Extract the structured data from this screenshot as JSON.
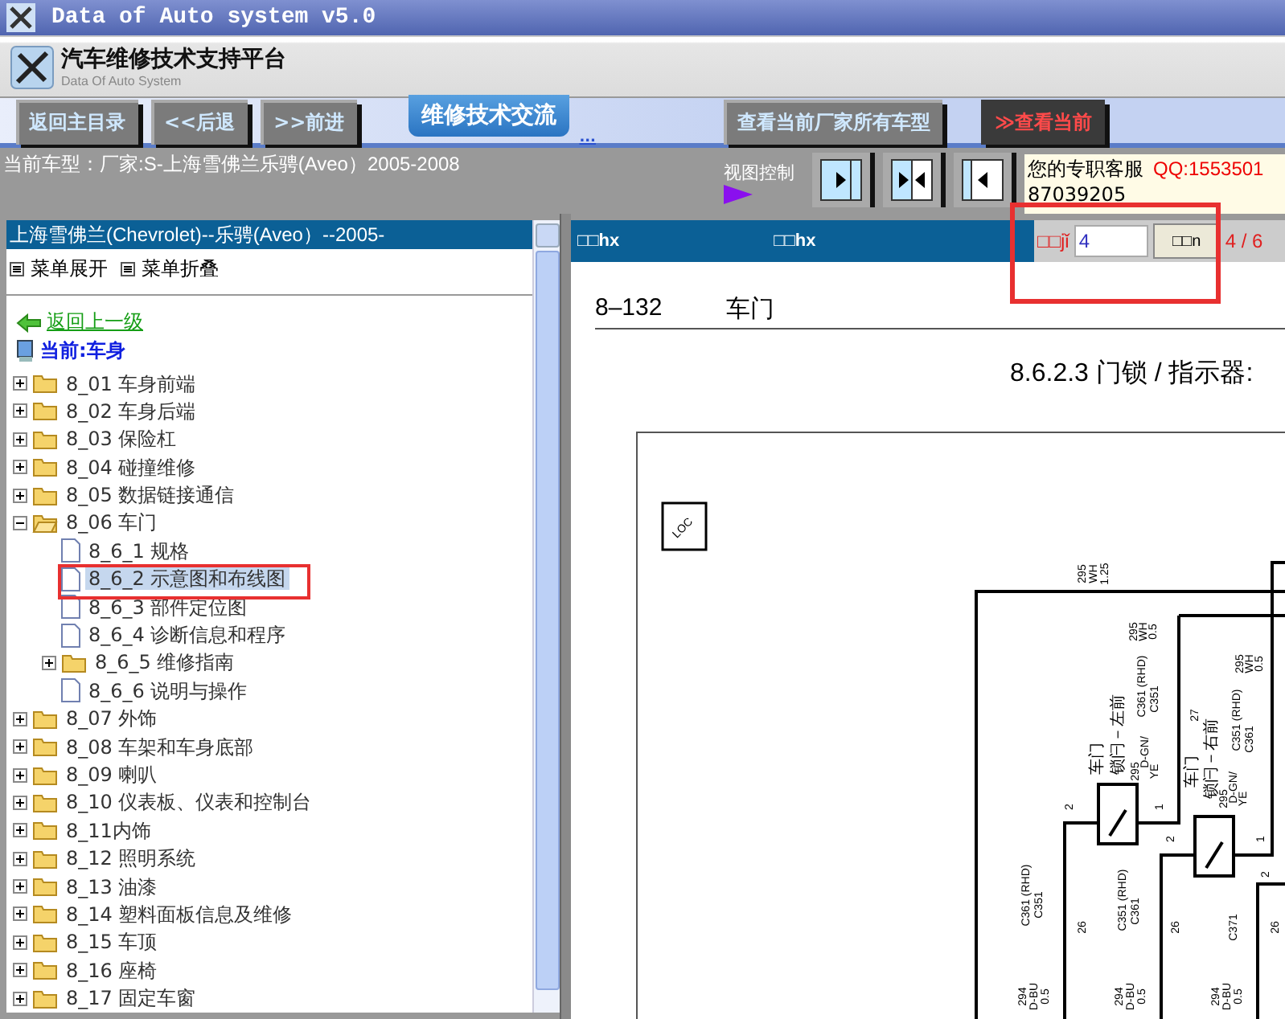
{
  "window": {
    "title": "Data of Auto system v5.0"
  },
  "header": {
    "title": "汽车维修技术支持平台",
    "subtitle": "Data Of Auto System"
  },
  "nav": {
    "buttons": [
      {
        "label": "返回主目录",
        "kind": "grey"
      },
      {
        "label": "<<后退",
        "kind": "grey"
      },
      {
        "label": ">>前进",
        "kind": "grey"
      },
      {
        "label": "维修技术交流",
        "kind": "tab"
      },
      {
        "label": "...",
        "kind": "link"
      },
      {
        "label": "查看当前厂家所有车型",
        "kind": "grey"
      },
      {
        "label": "≫查看当前",
        "kind": "red"
      }
    ]
  },
  "info_bar": {
    "current_model": "当前车型：厂家:S-上海雪佛兰乐骋(Aveo）2005-2008",
    "view_control": "视图控制",
    "service_label": "您的专职客服",
    "service_qq": "QQ:1553501",
    "service_phone": "87039205"
  },
  "sidebar": {
    "title": "上海雪佛兰(Chevrolet)--乐骋(Aveo）--2005-",
    "expand_all": "菜单展开",
    "collapse_all": "菜单折叠",
    "back_link": "返回上一级",
    "current": "当前:车身",
    "tree": [
      {
        "label": "8_01 车身前端",
        "kind": "folder",
        "expanded": false,
        "selected": false
      },
      {
        "label": "8_02 车身后端",
        "kind": "folder",
        "expanded": false,
        "selected": false
      },
      {
        "label": "8_03 保险杠",
        "kind": "folder",
        "expanded": false,
        "selected": false
      },
      {
        "label": "8_04 碰撞维修",
        "kind": "folder",
        "expanded": false,
        "selected": false
      },
      {
        "label": "8_05 数据链接通信",
        "kind": "folder",
        "expanded": false,
        "selected": false
      },
      {
        "label": "8_06 车门",
        "kind": "folder",
        "expanded": true,
        "selected": false,
        "children": [
          {
            "label": "8_6_1 规格",
            "kind": "doc",
            "selected": false
          },
          {
            "label": "8_6_2 示意图和布线图",
            "kind": "doc",
            "selected": true
          },
          {
            "label": "8_6_3 部件定位图",
            "kind": "doc",
            "selected": false
          },
          {
            "label": "8_6_4 诊断信息和程序",
            "kind": "doc",
            "selected": false
          },
          {
            "label": "8_6_5 维修指南",
            "kind": "folder",
            "expanded": false,
            "selected": false
          },
          {
            "label": "8_6_6 说明与操作",
            "kind": "doc",
            "selected": false
          }
        ]
      },
      {
        "label": "8_07 外饰",
        "kind": "folder",
        "expanded": false,
        "selected": false
      },
      {
        "label": "8_08 车架和车身底部",
        "kind": "folder",
        "expanded": false,
        "selected": false
      },
      {
        "label": "8_09 喇叭",
        "kind": "folder",
        "expanded": false,
        "selected": false
      },
      {
        "label": "8_10 仪表板、仪表和控制台",
        "kind": "folder",
        "expanded": false,
        "selected": false
      },
      {
        "label": "8_11内饰",
        "kind": "folder",
        "expanded": false,
        "selected": false
      },
      {
        "label": "8_12 照明系统",
        "kind": "folder",
        "expanded": false,
        "selected": false
      },
      {
        "label": "8_13 油漆",
        "kind": "folder",
        "expanded": false,
        "selected": false
      },
      {
        "label": "8_14 塑料面板信息及维修",
        "kind": "folder",
        "expanded": false,
        "selected": false
      },
      {
        "label": "8_15 车顶",
        "kind": "folder",
        "expanded": false,
        "selected": false
      },
      {
        "label": "8_16 座椅",
        "kind": "folder",
        "expanded": false,
        "selected": false
      },
      {
        "label": "8_17 固定车窗",
        "kind": "folder",
        "expanded": false,
        "selected": false
      }
    ]
  },
  "viewer": {
    "toolbar": {
      "label_1": "□□hx",
      "label_2": "□□hx",
      "page_label": "□□jǐ",
      "page_value": "4",
      "go_button": "□□n",
      "page_count": "4 / 6"
    },
    "page_header": {
      "number": "8–132",
      "section": "车门"
    },
    "title": "8.6.2.3 门锁 / 指示器:",
    "diagram_labels": [
      "LOC",
      "295",
      "WH",
      "1.25",
      "295",
      "WH",
      "0.5",
      "C361 (RHD)",
      "C351",
      "27",
      "车门",
      "锁闩－左前",
      "295",
      "D-GN/",
      "YE",
      "2",
      "1",
      "295",
      "WH",
      "0.5",
      "C351 (RHD)",
      "C361",
      "车门",
      "锁闩－右前",
      "295",
      "D-GN/",
      "YE",
      "2",
      "1",
      "2",
      "C361 (RHD)",
      "C351",
      "26",
      "C351 (RHD)",
      "C361",
      "26",
      "C371",
      "26",
      "294",
      "D-BU",
      "0.5",
      "294",
      "D-BU",
      "0.5",
      "294",
      "D-BU",
      "0.5"
    ]
  },
  "annotations": [
    {
      "kind": "highlight"
    },
    {
      "kind": "highlight"
    }
  ]
}
